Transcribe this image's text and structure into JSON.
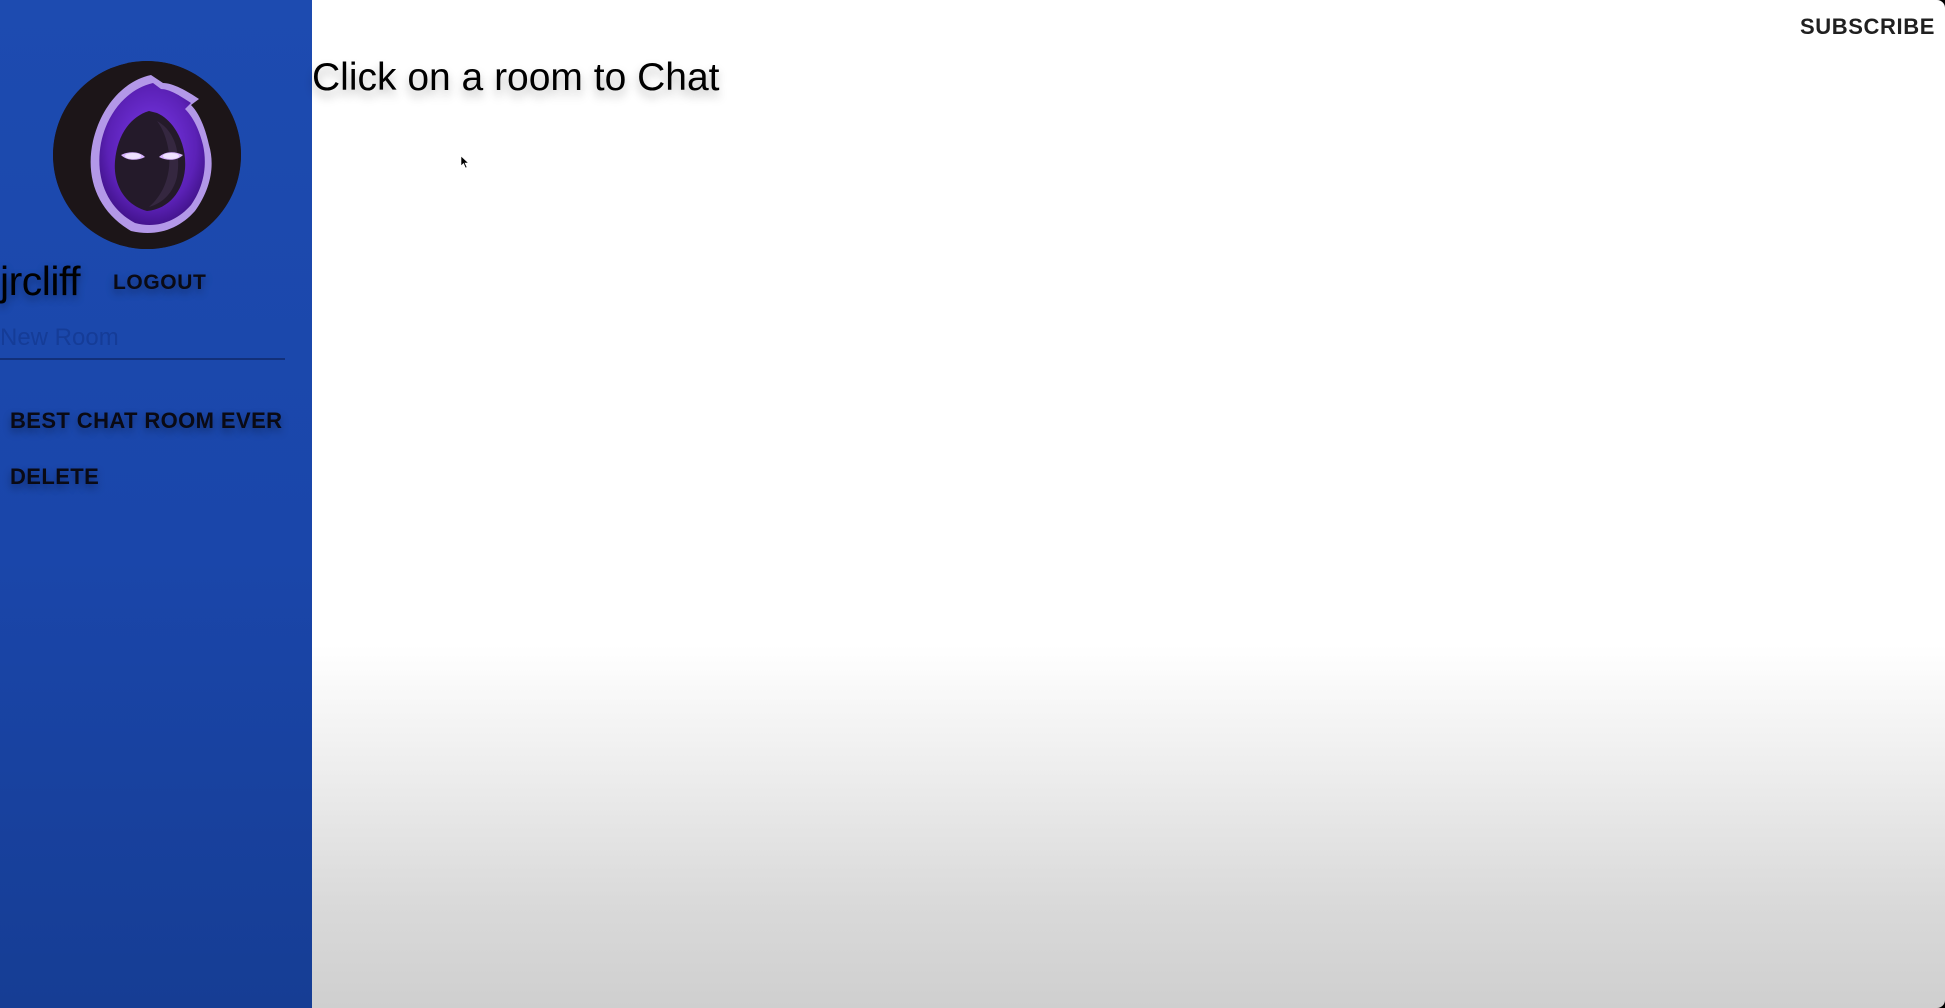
{
  "sidebar": {
    "username": "jrcliff",
    "logout_label": "LOGOUT",
    "new_room_placeholder": "New Room",
    "new_room_value": "",
    "rooms": [
      {
        "label": "BEST CHAT ROOM EVER"
      }
    ],
    "delete_label": "DELETE",
    "avatar_icon": "hooded-figure-logo",
    "background_color": "#1d4bb0"
  },
  "header": {
    "subscribe_label": "SUBSCRIBE"
  },
  "main": {
    "heading": "Click on a room to Chat"
  }
}
